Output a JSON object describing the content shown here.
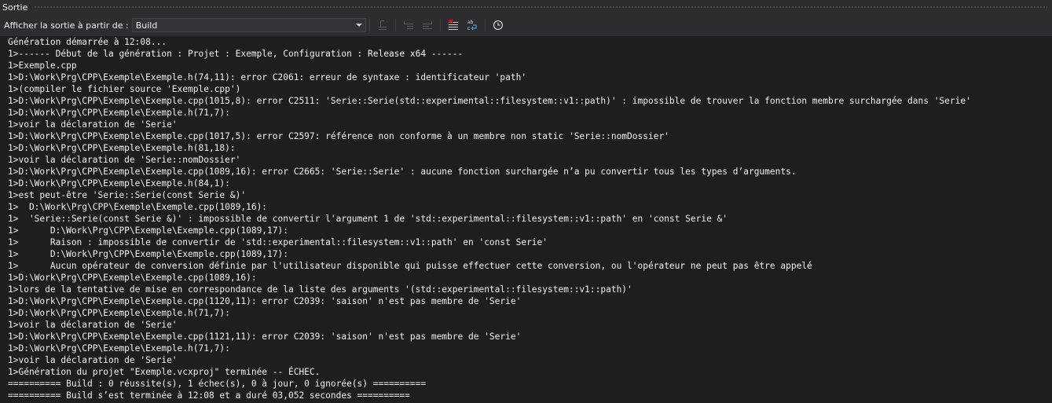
{
  "panel": {
    "title": "Sortie"
  },
  "toolbar": {
    "show_output_label": "Afficher la sortie à partir de :",
    "source_value": "Build",
    "icons": [
      "goto-line-icon",
      "prev-message-icon",
      "next-message-icon",
      "clear-all-icon",
      "word-wrap-icon",
      "timestamp-icon"
    ]
  },
  "output": {
    "lines": [
      "Génération démarrée à 12:08...",
      "1>------ Début de la génération : Projet : Exemple, Configuration : Release x64 ------",
      "1>Exemple.cpp",
      "1>D:\\Work\\Prg\\CPP\\Exemple\\Exemple.h(74,11): error C2061: erreur de syntaxe : identificateur 'path'",
      "1>(compiler le fichier source 'Exemple.cpp')",
      "1>D:\\Work\\Prg\\CPP\\Exemple\\Exemple.cpp(1015,8): error C2511: 'Serie::Serie(std::experimental::filesystem::v1::path)' : impossible de trouver la fonction membre surchargée dans 'Serie'",
      "1>D:\\Work\\Prg\\CPP\\Exemple\\Exemple.h(71,7):",
      "1>voir la déclaration de 'Serie'",
      "1>D:\\Work\\Prg\\CPP\\Exemple\\Exemple.cpp(1017,5): error C2597: référence non conforme à un membre non static 'Serie::nomDossier'",
      "1>D:\\Work\\Prg\\CPP\\Exemple\\Exemple.h(81,18):",
      "1>voir la déclaration de 'Serie::nomDossier'",
      "1>D:\\Work\\Prg\\CPP\\Exemple\\Exemple.cpp(1089,16): error C2665: 'Serie::Serie' : aucune fonction surchargée n’a pu convertir tous les types d’arguments.",
      "1>D:\\Work\\Prg\\CPP\\Exemple\\Exemple.h(84,1):",
      "1>est peut-être 'Serie::Serie(const Serie &)'",
      "1>  D:\\Work\\Prg\\CPP\\Exemple\\Exemple.cpp(1089,16):",
      "1>  'Serie::Serie(const Serie &)' : impossible de convertir l'argument 1 de 'std::experimental::filesystem::v1::path' en 'const Serie &'",
      "1>      D:\\Work\\Prg\\CPP\\Exemple\\Exemple.cpp(1089,17):",
      "1>      Raison : impossible de convertir de 'std::experimental::filesystem::v1::path' en 'const Serie'",
      "1>      D:\\Work\\Prg\\CPP\\Exemple\\Exemple.cpp(1089,17):",
      "1>      Aucun opérateur de conversion définie par l'utilisateur disponible qui puisse effectuer cette conversion, ou l'opérateur ne peut pas être appelé",
      "1>D:\\Work\\Prg\\CPP\\Exemple\\Exemple.cpp(1089,16):",
      "1>lors de la tentative de mise en correspondance de la liste des arguments '(std::experimental::filesystem::v1::path)'",
      "1>D:\\Work\\Prg\\CPP\\Exemple\\Exemple.cpp(1120,11): error C2039: 'saison' n'est pas membre de 'Serie'",
      "1>D:\\Work\\Prg\\CPP\\Exemple\\Exemple.h(71,7):",
      "1>voir la déclaration de 'Serie'",
      "1>D:\\Work\\Prg\\CPP\\Exemple\\Exemple.cpp(1121,11): error C2039: 'saison' n'est pas membre de 'Serie'",
      "1>D:\\Work\\Prg\\CPP\\Exemple\\Exemple.h(71,7):",
      "1>voir la déclaration de 'Serie'",
      "1>Génération du projet \"Exemple.vcxproj\" terminée -- ÉCHEC.",
      "========== Build : 0 réussite(s), 1 échec(s), 0 à jour, 0 ignorée(s) ==========",
      "========== Build s’est terminée à 12:08 et a duré 03,052 secondes =========="
    ]
  },
  "colors": {
    "background": "#1e1e1e",
    "toolbar": "#2d2d30",
    "text": "#f1f1f1"
  }
}
